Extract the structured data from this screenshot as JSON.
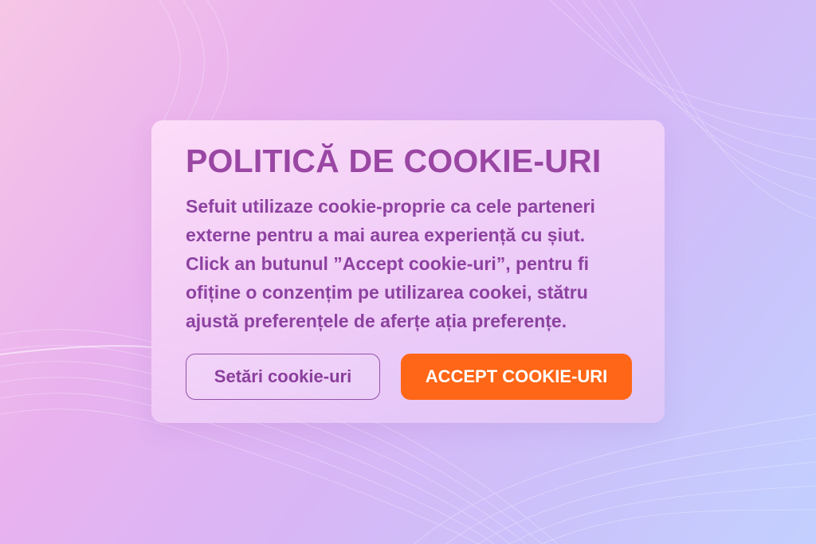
{
  "cookie_banner": {
    "title": "POLITICĂ DE COOKIE-URI",
    "body": "Sefuit utilizaze cookie-proprie ca cele parteneri\nexterne pentru a mai aurea experiență cu șiut.\nClick an butunul ”Accept cookie-uri”, pentru fi\nofiține o conzențim pe utilizarea cookei, stătru\najustă preferențele de aferțe ația preferențe.",
    "settings_button": "Setări cookie-uri",
    "accept_button": "ACCEPT COOKIE-URI"
  },
  "colors": {
    "title": "#9a47a4",
    "body_text": "#8d42a0",
    "accept_button_bg": "#ff6617",
    "settings_button_border": "#9452a8"
  }
}
